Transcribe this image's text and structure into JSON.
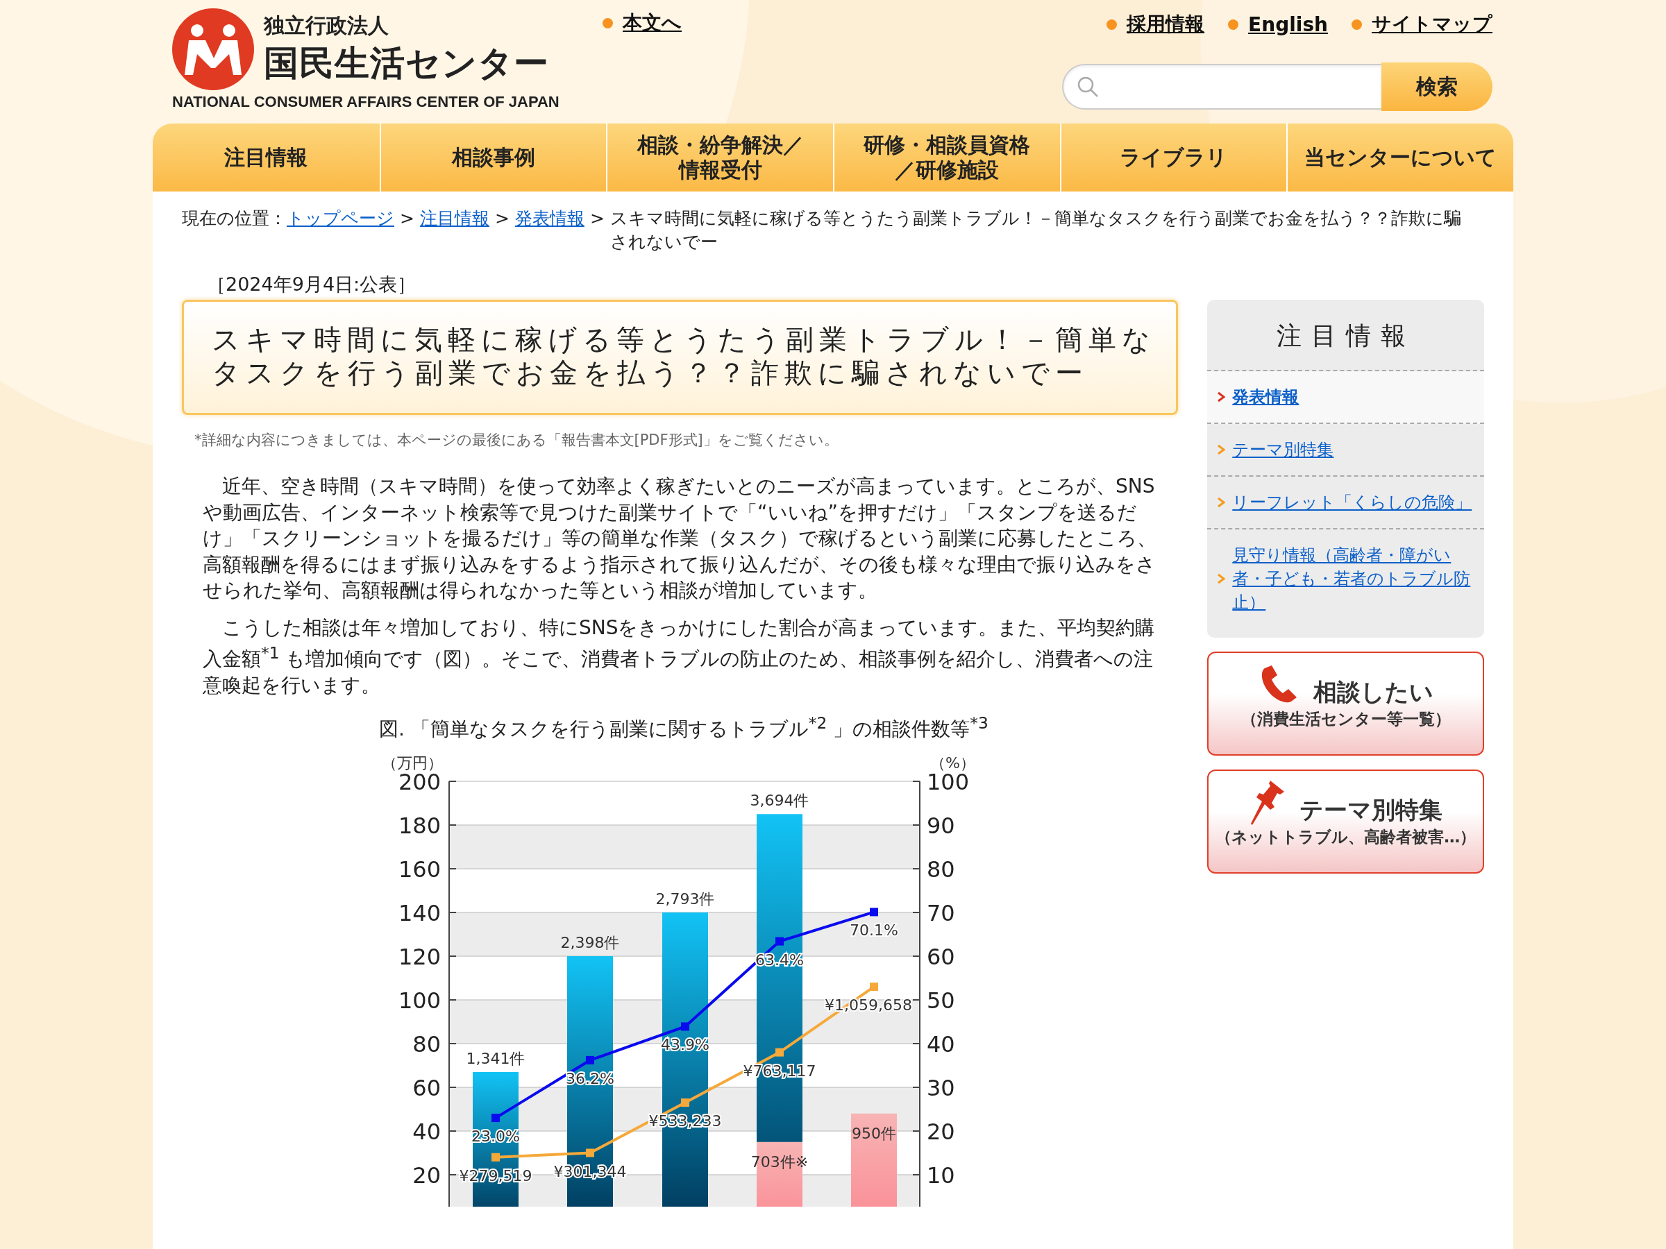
{
  "header": {
    "org_type": "独立行政法人",
    "org_name": "国民生活センター",
    "org_name_en": "NATIONAL CONSUMER AFFAIRS CENTER OF JAPAN",
    "skip_link": "本文へ",
    "utility_links": [
      "採用情報",
      "English",
      "サイトマップ"
    ],
    "search": {
      "button": "検索"
    }
  },
  "nav": [
    "注目情報",
    "相談事例",
    "相談・紛争解決／情報受付",
    "研修・相談員資格／研修施設",
    "ライブラリ",
    "当センターについて"
  ],
  "breadcrumb": {
    "label": "現在の位置：",
    "links": [
      "トップページ",
      "注目情報",
      "発表情報"
    ],
    "separator": ">",
    "current": "スキマ時間に気軽に稼げる等とうたう副業トラブル！－簡単なタスクを行う副業でお金を払う？？詐欺に騙されないでー"
  },
  "article": {
    "date": "［2024年9月4日:公表］",
    "title": "スキマ時間に気軽に稼げる等とうたう副業トラブル！－簡単なタスクを行う副業でお金を払う？？詐欺に騙されないでー",
    "note": "*詳細な内容につきましては、本ページの最後にある「報告書本文[PDF形式]」をご覧ください。",
    "paragraphs": [
      "近年、空き時間（スキマ時間）を使って効率よく稼ぎたいとのニーズが高まっています。ところが、SNSや動画広告、インターネット検索等で見つけた副業サイトで「“いいね”を押すだけ」「スタンプを送るだけ」「スクリーンショットを撮るだけ」等の簡単な作業（タスク）で稼げるという副業に応募したところ、高額報酬を得るにはまず振り込みをするよう指示されて振り込んだが、その後も様々な理由で振り込みをさせられた挙句、高額報酬は得られなかった等という相談が増加しています。",
      "こうした相談は年々増加しており、特にSNSをきっかけにした割合が高まっています。また、平均契約購入金額$^{*1}$ も増加傾向です（図）。そこで、消費者トラブルの防止のため、相談事例を紹介し、消費者への注意喚起を行います。"
    ],
    "figure_caption": "図. 「簡単なタスクを行う副業に関するトラブル$^{*2}$ 」の相談件数等$^{*3}$",
    "chart_data": {
      "type": "bar",
      "ylabel": "（万円）",
      "y2label": "（%）",
      "ylim": [
        0,
        200
      ],
      "y2lim": [
        0,
        100
      ],
      "yticks": [
        20,
        40,
        60,
        80,
        100,
        120,
        140,
        160,
        180,
        200
      ],
      "y2ticks": [
        10,
        20,
        30,
        40,
        50,
        60,
        70,
        80,
        90,
        100
      ],
      "grid": true,
      "data_labels": true,
      "series": [
        {
          "type": "bar",
          "color": "#12c3f5",
          "values": [
            67,
            120,
            140,
            185,
            null
          ],
          "value_labels": [
            null,
            null,
            null,
            null,
            null
          ]
        },
        {
          "type": "bar",
          "color": "#f8b4b4",
          "values": [
            null,
            null,
            null,
            35,
            48
          ],
          "value_labels": [
            null,
            null,
            null,
            null,
            null
          ]
        },
        {
          "type": "line",
          "axis": "y2",
          "marker": "square",
          "color": "#0a0aee",
          "values": [
            23.0,
            36.2,
            43.9,
            63.4,
            70.1
          ],
          "value_labels": [
            "23.0%",
            "36.2%",
            "43.9%",
            "63.4%",
            "70.1%"
          ]
        },
        {
          "type": "line",
          "marker": "square",
          "color": "#f5a93a",
          "values": [
            28,
            30,
            53,
            76,
            106
          ],
          "value_labels": [
            null,
            null,
            null,
            null,
            null
          ]
        }
      ],
      "annotations": [
        "1,341件",
        "2,398件",
        "2,793件",
        "3,694件",
        "703件※",
        "950件",
        "¥279,519",
        "¥301,344",
        "¥533,233",
        "¥763,117",
        "¥1,059,658"
      ]
    }
  },
  "sidebar": {
    "heading": "注目情報",
    "items": [
      {
        "label": "発表情報",
        "selected": true
      },
      {
        "label": "テーマ別特集",
        "selected": false
      },
      {
        "label": "リーフレット「くらしの危険」",
        "selected": false
      },
      {
        "label": "見守り情報（高齢者・障がい者・子ども・若者のトラブル防止）",
        "selected": false
      }
    ],
    "banners": [
      {
        "kind": "phone",
        "title": "相談したい",
        "subtitle": "（消費生活センター等一覧）"
      },
      {
        "kind": "pin",
        "title": "テーマ別特集",
        "subtitle": "（ネットトラブル、高齢者被害…）"
      }
    ]
  }
}
